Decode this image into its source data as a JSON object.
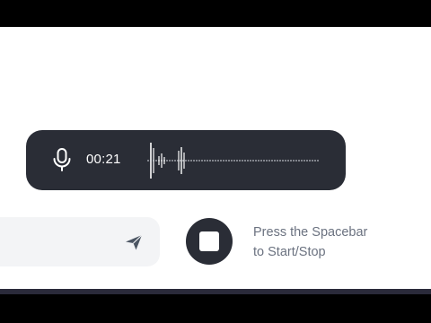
{
  "recorder": {
    "elapsed": "00:21",
    "mic_icon": "microphone-icon",
    "waveform_icon": "waveform-icon"
  },
  "composer": {
    "input_value": "",
    "send_icon": "send-icon"
  },
  "stop_control": {
    "icon": "stop-icon",
    "hint_line1": "Press the Spacebar",
    "hint_line2": "to Start/Stop"
  },
  "colors": {
    "recorder_bg": "#2a2d36",
    "stop_button": "#2a2d36",
    "hint_text": "#6b7280",
    "input_bg": "#f3f4f6"
  }
}
